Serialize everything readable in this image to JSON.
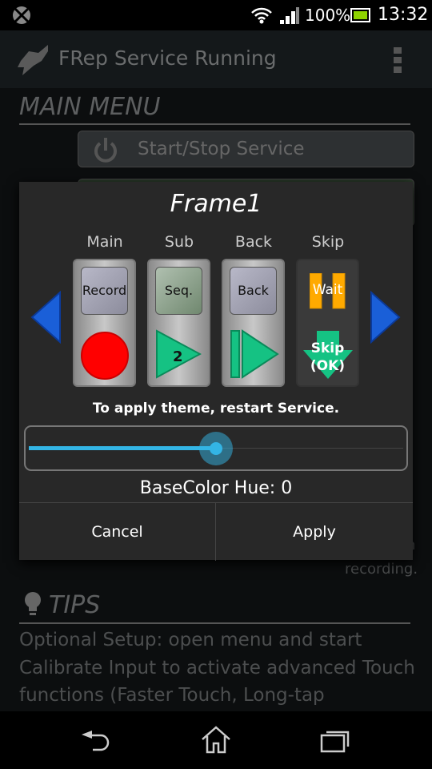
{
  "status_bar": {
    "battery": "100%",
    "time": "13:32",
    "icons": [
      "app-notification-icon",
      "wifi-icon",
      "signal-icon",
      "battery-icon"
    ]
  },
  "app_bar": {
    "title": "FRep Service Running",
    "icon": "hand-logo-icon",
    "menu_icon": "overflow-menu-icon"
  },
  "main": {
    "section_title": "MAIN MENU",
    "start_stop_label": "Start/Stop Service",
    "partial_text_1": "n",
    "partial_text_2": "recording.",
    "tips_title": "TIPS",
    "tips_text": "Optional Setup: open menu and start Calibrate Input to activate advanced Touch functions (Faster Touch, Long-tap"
  },
  "dialog": {
    "title": "Frame1",
    "columns": [
      {
        "header": "Main",
        "label": "Record",
        "icon": "record-circle-icon"
      },
      {
        "header": "Sub",
        "label": "Seq.",
        "icon": "play-icon",
        "badge": "2"
      },
      {
        "header": "Back",
        "label": "Back",
        "icon": "play-from-start-icon"
      },
      {
        "header": "Skip",
        "label": "Wait",
        "icon": "skip-down-arrow-icon",
        "skip_label": "Skip",
        "skip_sub": "(OK)"
      }
    ],
    "note": "To apply theme, restart Service.",
    "slider_value_fraction": 0.5,
    "hue_label": "BaseColor Hue: 0",
    "cancel": "Cancel",
    "apply": "Apply",
    "colors": {
      "accent": "#33b5e5",
      "record": "#ff0000",
      "play": "#15c283",
      "wait": "#ffaa00",
      "arrow": "#1a5fd8"
    }
  }
}
